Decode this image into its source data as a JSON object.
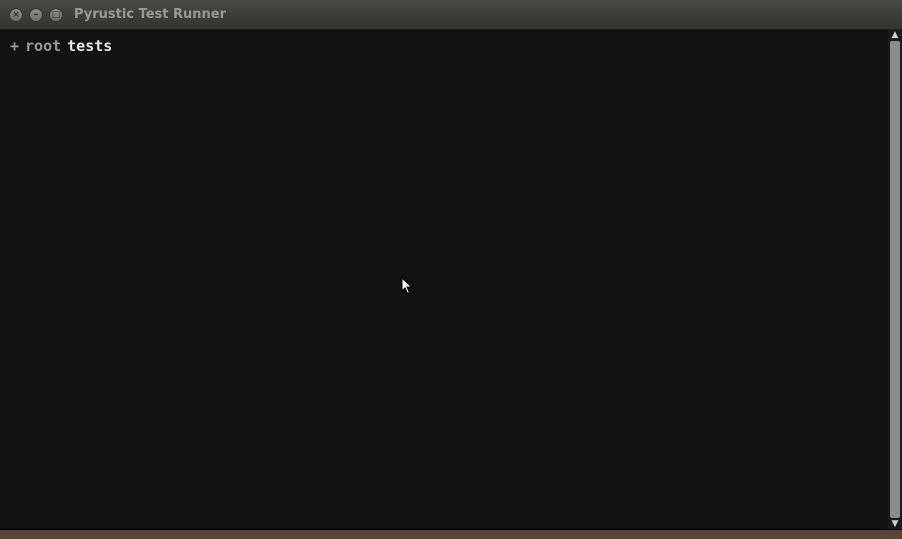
{
  "window": {
    "title": "Pyrustic Test Runner",
    "buttons": {
      "close_glyph": "×",
      "minimize_glyph": "–",
      "maximize_glyph": "□"
    }
  },
  "tree": {
    "expander": "+",
    "root_label": "root",
    "child_label": "tests"
  },
  "scrollbar": {
    "up_glyph": "▲",
    "down_glyph": "▼"
  },
  "colors": {
    "background": "#121212",
    "text_dim": "#9a9a9a",
    "text_bright": "#e6e6e6",
    "titlebar": "#3c3b37"
  },
  "icons": {
    "cursor": "arrow-cursor-icon"
  }
}
